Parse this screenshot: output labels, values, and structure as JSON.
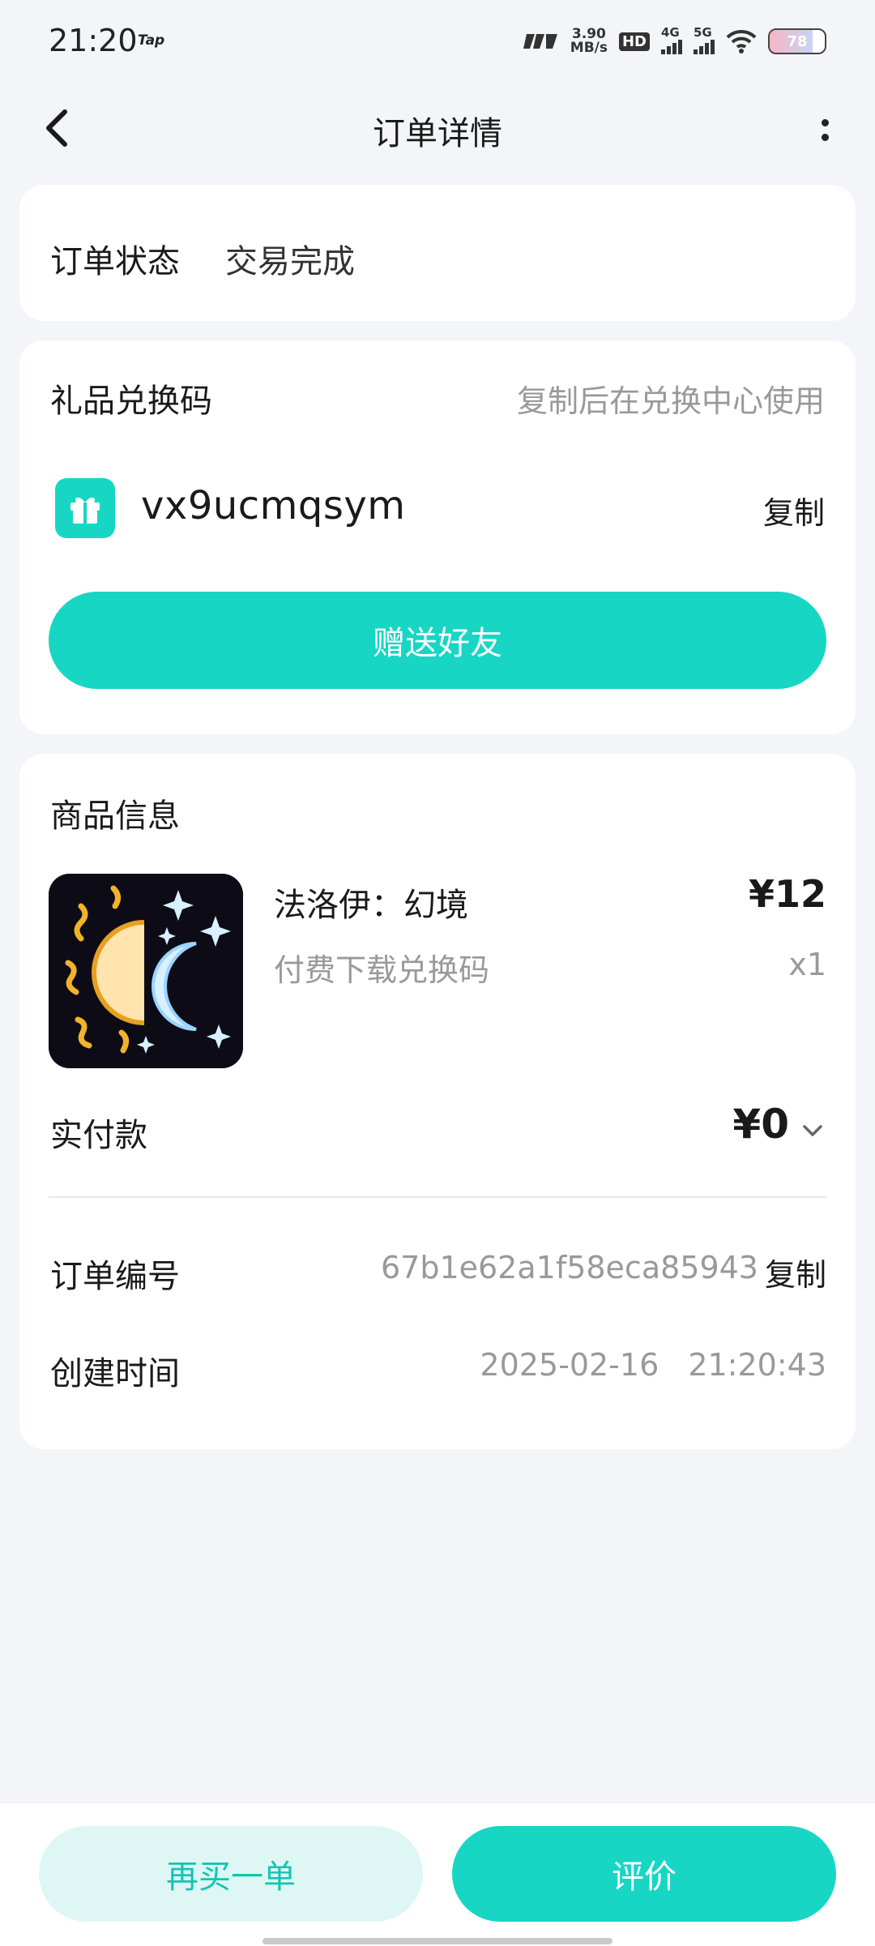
{
  "status_bar": {
    "time": "21:20",
    "app_tag": "Tap",
    "net_speed_value": "3.90",
    "net_speed_unit": "MB/s",
    "hd_label": "HD",
    "sim1_label": "4G",
    "sim2_label": "5G",
    "battery": "78",
    "battery_level": 0.78
  },
  "header": {
    "title": "订单详情"
  },
  "order_status": {
    "label": "订单状态",
    "value": "交易完成"
  },
  "gift_code": {
    "title": "礼品兑换码",
    "hint": "复制后在兑换中心使用",
    "code": "vx9ucmqsym",
    "copy_label": "复制",
    "send_label": "赠送好友",
    "icon": "gift-icon"
  },
  "product": {
    "section_title": "商品信息",
    "name": "法洛伊：幻境",
    "subtitle": "付费下载兑换码",
    "price": "¥12",
    "quantity": "x1",
    "paid_label": "实付款",
    "paid_value": "¥0",
    "order_no_label": "订单编号",
    "order_no": "67b1e62a1f58eca85943",
    "order_copy_label": "复制",
    "created_label": "创建时间",
    "created_time": "2025-02-16 21:20:43"
  },
  "bottom": {
    "rebuy_label": "再买一单",
    "review_label": "评价"
  },
  "colors": {
    "accent": "#17d6c4",
    "accent_light": "#dff7f4",
    "background": "#f4f5f9"
  }
}
